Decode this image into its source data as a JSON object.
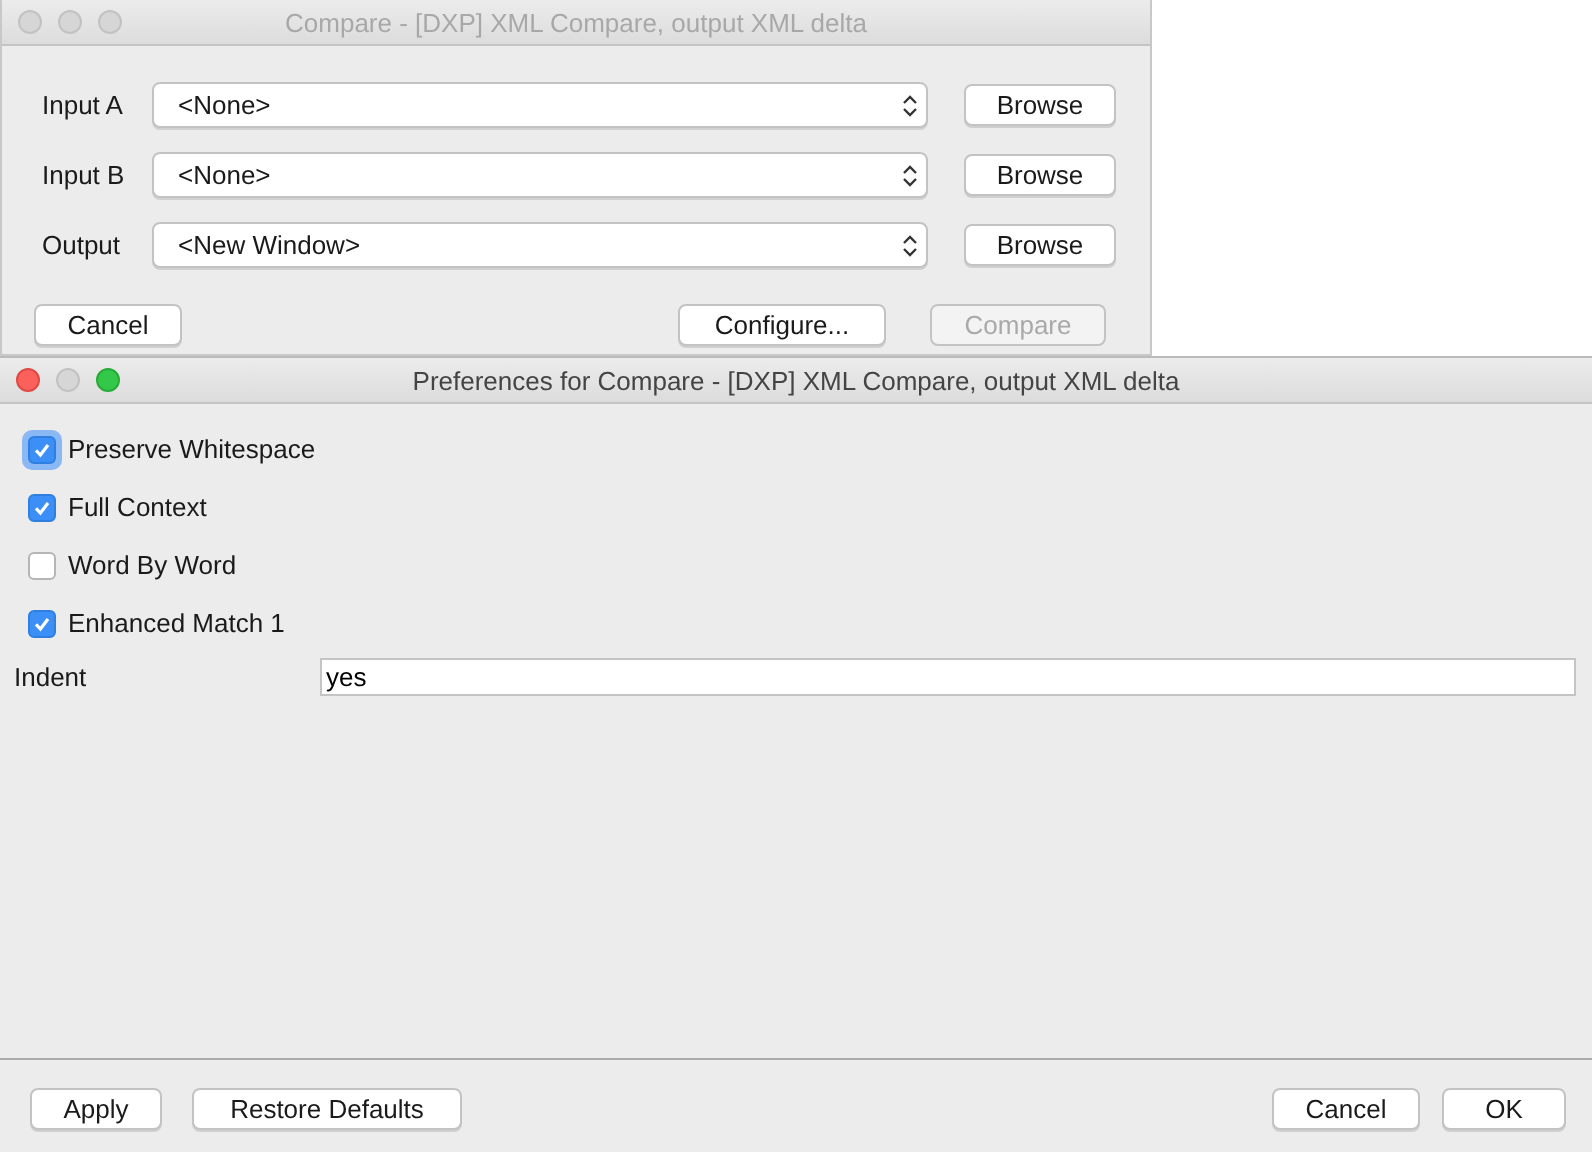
{
  "compare_window": {
    "title": "Compare - [DXP] XML Compare, output XML delta",
    "rows": [
      {
        "label": "Input A",
        "value": "<None>",
        "button": "Browse"
      },
      {
        "label": "Input B",
        "value": "<None>",
        "button": "Browse"
      },
      {
        "label": "Output",
        "value": "<New Window>",
        "button": "Browse"
      }
    ],
    "buttons": [
      {
        "label": "Cancel",
        "disabled": false
      },
      {
        "label": "Configure...",
        "disabled": false
      },
      {
        "label": "Compare",
        "disabled": true
      }
    ]
  },
  "preferences_window": {
    "title": "Preferences for Compare - [DXP] XML Compare, output XML delta",
    "options": [
      {
        "label": "Preserve Whitespace",
        "checked": true,
        "focused": true
      },
      {
        "label": "Full Context",
        "checked": true,
        "focused": false
      },
      {
        "label": "Word By Word",
        "checked": false,
        "focused": false
      },
      {
        "label": "Enhanced Match 1",
        "checked": true,
        "focused": false
      }
    ],
    "indent": {
      "label": "Indent",
      "value": "yes"
    },
    "left_buttons": [
      "Apply",
      "Restore Defaults"
    ],
    "right_buttons": [
      "Cancel",
      "OK"
    ]
  }
}
